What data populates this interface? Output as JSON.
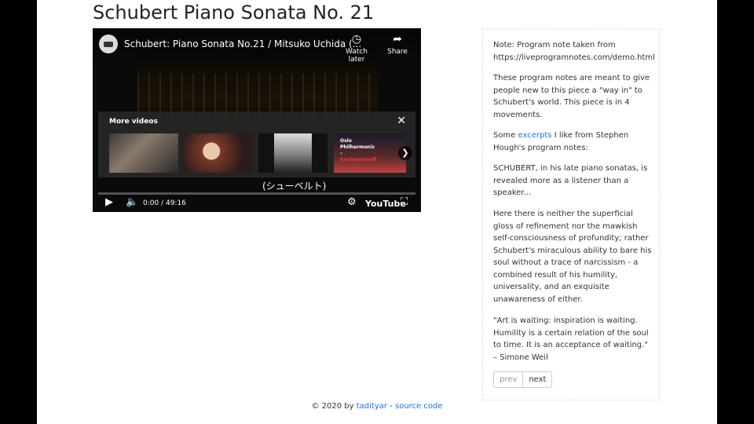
{
  "page": {
    "title": "Schubert Piano Sonata No. 21"
  },
  "video": {
    "title": "Schubert: Piano Sonata No.21 / Mitsuko Uchida (...",
    "watch_later": "Watch later",
    "share": "Share",
    "more_videos": "More videos",
    "thumb4_lines": [
      "Oslo",
      "Philharmonic",
      "–",
      "Rachmaninoff"
    ],
    "caption": "(シューベルト)",
    "time": "0:00 / 49:16",
    "brand": "YouTube",
    "progress": 0.0
  },
  "notes": {
    "p1": "Note: Program note taken from https://liveprogramnotes.com/demo.html",
    "p2": "These program notes are meant to give people new to this piece a \"way in\" to Schubert's world. This piece is in 4 movements.",
    "p3_pre": "Some ",
    "p3_link": "excerpts",
    "p3_post": " I like from Stephen Hough's program notes:",
    "p4": "SCHUBERT, in his late piano sonatas, is revealed more as a listener than a speaker...",
    "p5": "Here there is neither the superficial gloss of refinement nor the mawkish self-consciousness of profundity; rather Schubert's miraculous ability to bare his soul without a trace of narcissism - a combined result of his humility, universality, and an exquisite unawareness of either.",
    "p6": "\"Art is waiting: inspiration is waiting. Humility is a certain relation of the soul to time. It is an acceptance of waiting.\" – Simone Weil",
    "prev": "prev",
    "next": "next"
  },
  "footer": {
    "prefix": "© 2020 by ",
    "author": "tadityar",
    "sep": " - ",
    "source": "source code"
  },
  "colors": {
    "link": "#1a73e8",
    "progress": "#ff0000"
  },
  "icons": [
    "clock-icon",
    "share-icon",
    "close-icon",
    "chevron-right-icon",
    "play-icon",
    "volume-icon",
    "gear-icon",
    "fullscreen-icon"
  ]
}
